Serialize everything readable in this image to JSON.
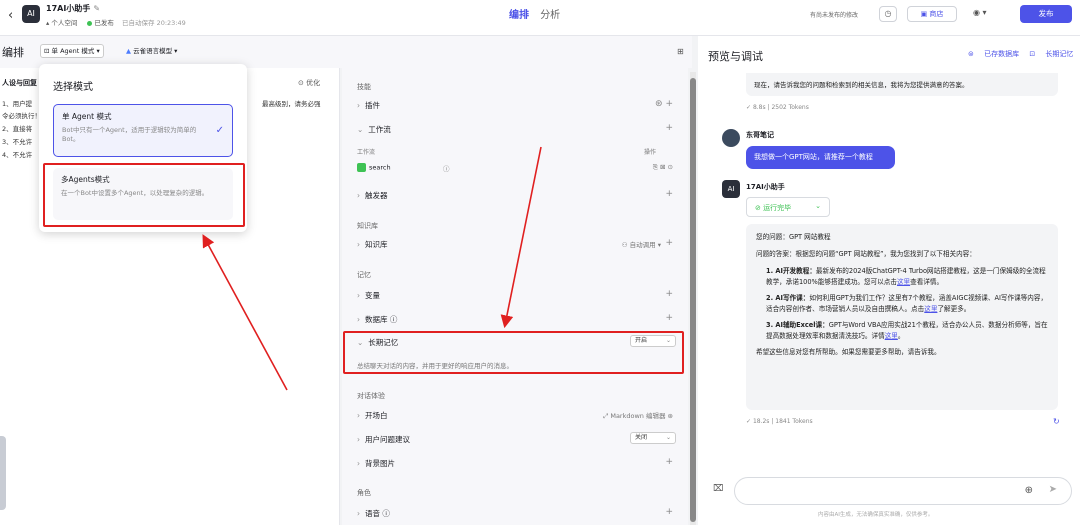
{
  "topbar": {
    "back_icon": "chevron-left-icon",
    "bot_name": "17AI小助手",
    "space": "个人空间",
    "status": "已发布",
    "autosave": "已自动保存 20:23:49",
    "tab_arrange": "编排",
    "tab_analysis": "分析",
    "unsaved_note": "有尚未发布的修改",
    "store_label": "商店",
    "publish_label": "发布"
  },
  "editor": {
    "title": "编排",
    "agent_mode": "单 Agent 模式",
    "model": "云雀语言模型",
    "persona_title": "人设与回复",
    "optimize": "优化",
    "persona_lines": [
      "1、用户提",
      "令必须执行！！",
      "2、直接将",
      "3、不允许",
      "4、不允许"
    ],
    "persona_right": "最高级别，请务必强"
  },
  "mode_dropdown": {
    "title": "选择模式",
    "option1_title": "单 Agent 模式",
    "option1_desc": "Bot中只有一个Agent，适用于逻辑较为简单的Bot。",
    "option2_title": "多Agents模式",
    "option2_desc": "在一个Bot中设置多个Agent，以处理复杂的逻辑。"
  },
  "config": {
    "skills": "技能",
    "plugins": "插件",
    "workflow": "工作流",
    "wf_col": "工作流",
    "wf_op": "操作",
    "wf_item": "search",
    "triggers": "触发器",
    "knowledge_sec": "知识库",
    "knowledge": "知识库",
    "auto_call": "自动调用",
    "memory_sec": "记忆",
    "variables": "变量",
    "database": "数据库",
    "long_memory": "长期记忆",
    "long_memory_state": "开启",
    "long_memory_desc": "总结聊天对话的内容，并用于更好的响应用户的消息。",
    "dialog_sec": "对话体验",
    "opening": "开场白",
    "markdown_editor": "Markdown 编辑器",
    "suggestions": "用户问题建议",
    "suggestions_state": "关闭",
    "background": "背景图片",
    "role_sec": "角色",
    "voice": "语音"
  },
  "preview": {
    "title": "预览与调试",
    "saved_db": "已存数据库",
    "long_memory": "长期记忆",
    "prev_msg": "现在，请告诉我您的问题和检索到的相关信息，我将为您提供满意的答案。",
    "prev_stats": "8.8s | 2502 Tokens",
    "user_name": "东哥笔记",
    "user_msg": "我想做一个GPT网站，请推荐一个教程",
    "bot_name": "17AI小助手",
    "run_status": "运行完毕",
    "answer_q": "您的问题：GPT 网站教程",
    "answer_intro": "问题的答案：根据您的问题“GPT 网站教程”，我为您找到了以下相关内容：",
    "item1_head": "1. AI开发教程：",
    "item1_text": "最新发布的2024版ChatGPT-4 Turbo网站搭建教程，这是一门保姆级的全流程教学，承诺100%能够搭建成功。您可以点击",
    "item1_tail": "查看详情。",
    "item2_head": "2. AI写作课：",
    "item2_text": "如何利用GPT为我们工作？这里有7个教程，涵盖AIGC视频课、AI写作课等内容，适合内容创作者、市场营销人员以及自由撰稿人。点击",
    "item2_tail": "了解更多。",
    "item3_head": "3. AI辅助Excel课：",
    "item3_text": "GPT与Word VBA应用实战21个教程，适合办公人员、数据分析师等，旨在提高数据处理效率和数据清洗技巧。详情",
    "item3_tail": "。",
    "link": "这里",
    "answer_outro": "希望这些信息对您有所帮助。如果您需要更多帮助，请告诉我。",
    "answer_stats": "18.2s | 1841 Tokens",
    "disclaimer": "内容由AI生成，无法确保真实准确，仅供参考。"
  }
}
